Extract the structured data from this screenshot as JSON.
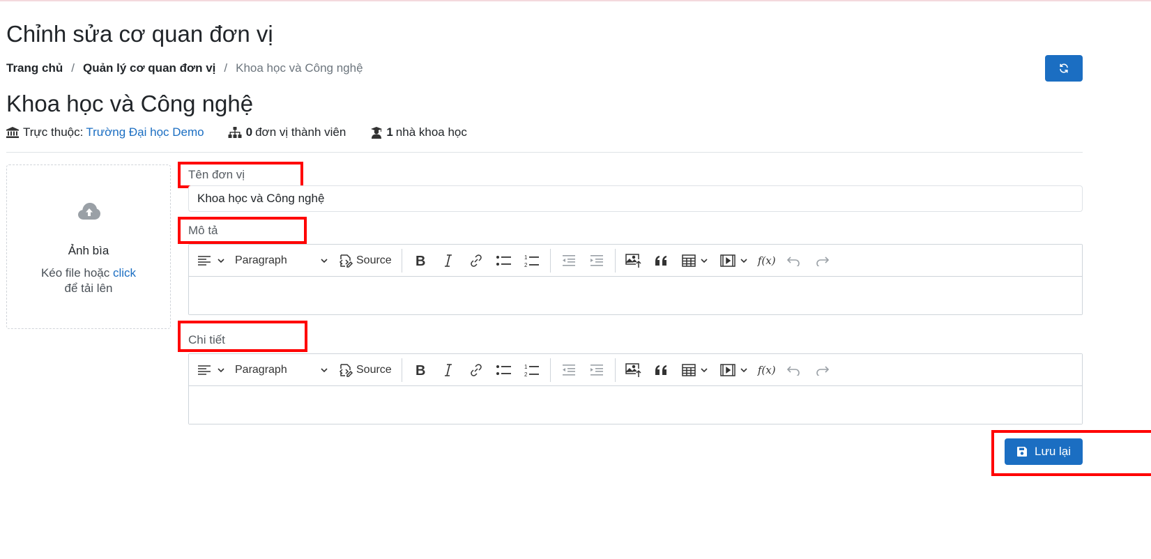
{
  "page": {
    "title": "Chỉnh sửa cơ quan đơn vị"
  },
  "breadcrumb": {
    "home": "Trang chủ",
    "manage": "Quản lý cơ quan đơn vị",
    "current": "Khoa học và Công nghệ",
    "separator": "/"
  },
  "org": {
    "name": "Khoa học và Công nghệ",
    "parent_label": "Trực thuộc:",
    "parent_name": "Trường Đại học Demo",
    "member_count": "0",
    "member_label": "đơn vị thành viên",
    "scientist_count": "1",
    "scientist_label": "nhà khoa học"
  },
  "cover": {
    "title": "Ảnh bìa",
    "hint_prefix": "Kéo file hoặc",
    "hint_click": "click",
    "hint_suffix": "để tải lên"
  },
  "form": {
    "name_label": "Tên đơn vị",
    "name_value": "Khoa học và Công nghệ",
    "description_label": "Mô tả",
    "detail_label": "Chi tiết"
  },
  "editor": {
    "paragraph_label": "Paragraph",
    "source_label": "Source",
    "formula_label": "f(x)"
  },
  "actions": {
    "save_label": "Lưu lại"
  },
  "colors": {
    "primary": "#1b6ec2",
    "highlight": "#ff0000"
  }
}
